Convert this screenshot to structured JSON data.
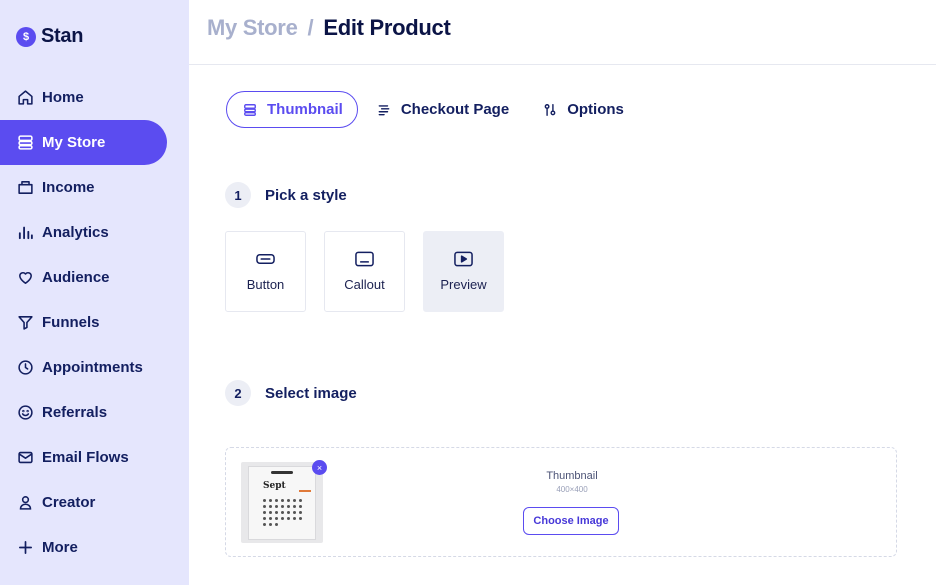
{
  "app": {
    "logo_symbol": "$",
    "logo_text": "Stan"
  },
  "sidebar": {
    "items": [
      {
        "label": "Home",
        "icon": "home-icon"
      },
      {
        "label": "My Store",
        "icon": "store-icon",
        "active": true
      },
      {
        "label": "Income",
        "icon": "wallet-icon"
      },
      {
        "label": "Analytics",
        "icon": "bar-chart-icon"
      },
      {
        "label": "Audience",
        "icon": "heart-icon"
      },
      {
        "label": "Funnels",
        "icon": "funnel-icon"
      },
      {
        "label": "Appointments",
        "icon": "clock-icon"
      },
      {
        "label": "Referrals",
        "icon": "smiley-icon"
      },
      {
        "label": "Email Flows",
        "icon": "mail-icon"
      },
      {
        "label": "Creator",
        "icon": "user-icon"
      },
      {
        "label": "More",
        "icon": "plus-icon"
      }
    ]
  },
  "header": {
    "parent": "My Store",
    "separator": "/",
    "current": "Edit Product"
  },
  "tabs": [
    {
      "label": "Thumbnail",
      "icon": "layers-icon",
      "active": true
    },
    {
      "label": "Checkout Page",
      "icon": "lines-icon"
    },
    {
      "label": "Options",
      "icon": "sliders-icon"
    }
  ],
  "steps": [
    {
      "number": "1",
      "title": "Pick a style"
    },
    {
      "number": "2",
      "title": "Select image"
    }
  ],
  "styles": [
    {
      "label": "Button",
      "icon": "button-icon"
    },
    {
      "label": "Callout",
      "icon": "callout-icon"
    },
    {
      "label": "Preview",
      "icon": "play-icon",
      "selected": true
    }
  ],
  "image_upload": {
    "thumbnail_month": "Sept",
    "remove_symbol": "×",
    "title": "Thumbnail",
    "size": "400×400",
    "choose_label": "Choose Image"
  },
  "colors": {
    "accent": "#5b4cf0",
    "sidebar_bg": "#e5e6fd",
    "text_dark": "#131f60",
    "breadcrumb_muted": "#a8b0cd"
  }
}
